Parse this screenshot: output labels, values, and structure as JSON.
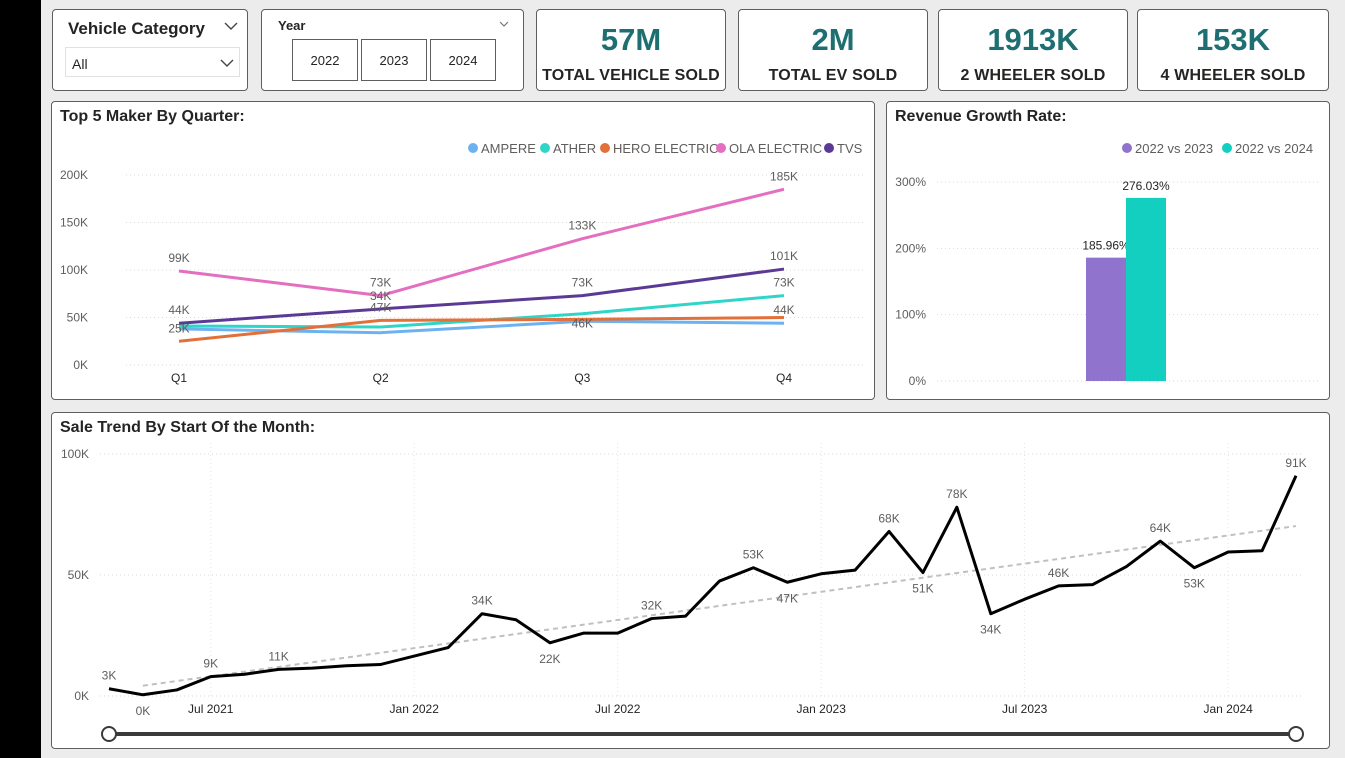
{
  "slicers": {
    "vehicle_category": {
      "title": "Vehicle Category",
      "selected": "All"
    },
    "year": {
      "title": "Year",
      "options": [
        "2022",
        "2023",
        "2024"
      ]
    }
  },
  "kpis": [
    {
      "value": "57M",
      "label": "TOTAL VEHICLE SOLD"
    },
    {
      "value": "2M",
      "label": "TOTAL EV SOLD"
    },
    {
      "value": "1913K",
      "label": "2 WHEELER SOLD"
    },
    {
      "value": "153K",
      "label": "4 WHEELER SOLD"
    }
  ],
  "colors": {
    "kpi_value": "#1e6f72",
    "ampere": "#6cb2f0",
    "ather": "#2fd5c8",
    "hero_electric": "#e2703a",
    "ola_electric": "#e46ec0",
    "tvs": "#5b3a96",
    "growth_2023": "#8f73cc",
    "growth_2024": "#12cfc0",
    "trend_line": "#000000",
    "trend_dashed": "#c0c0c0"
  },
  "chart_data": [
    {
      "type": "line",
      "title": "Top 5 Maker By Quarter:",
      "categories": [
        "Q1",
        "Q2",
        "Q3",
        "Q4"
      ],
      "yticks": [
        "0K",
        "50K",
        "100K",
        "150K",
        "200K"
      ],
      "ylim": [
        0,
        200000
      ],
      "legend": "top-right",
      "grid": true,
      "series": [
        {
          "name": "AMPERE",
          "color_key": "ampere",
          "values": [
            38000,
            34000,
            46000,
            44000
          ],
          "labels": [
            "",
            "",
            "",
            "44K"
          ]
        },
        {
          "name": "ATHER",
          "color_key": "ather",
          "values": [
            41000,
            40000,
            54000,
            73000
          ],
          "labels": [
            "",
            "",
            "",
            "73K"
          ]
        },
        {
          "name": "HERO ELECTRIC",
          "color_key": "hero_electric",
          "values": [
            25000,
            47000,
            48000,
            50000
          ],
          "labels": [
            "25K",
            "47K",
            "",
            ""
          ]
        },
        {
          "name": "OLA ELECTRIC",
          "color_key": "ola_electric",
          "values": [
            99000,
            73000,
            133000,
            185000
          ],
          "labels": [
            "99K",
            "73K",
            "133K",
            "185K"
          ]
        },
        {
          "name": "TVS",
          "color_key": "tvs",
          "values": [
            44000,
            59000,
            73000,
            101000
          ],
          "labels": [
            "44K",
            "34K",
            "73K",
            "101K"
          ]
        }
      ],
      "extra_labels": [
        "46K"
      ]
    },
    {
      "type": "bar",
      "title": "Revenue Growth Rate:",
      "yticks": [
        "0%",
        "100%",
        "200%",
        "300%"
      ],
      "ylim": [
        0,
        300
      ],
      "legend": "top-right",
      "grid": true,
      "series": [
        {
          "name": "2022 vs 2023",
          "color_key": "growth_2023",
          "value": 185.96,
          "label": "185.96%"
        },
        {
          "name": "2022 vs 2024",
          "color_key": "growth_2024",
          "value": 276.03,
          "label": "276.03%"
        }
      ]
    },
    {
      "type": "line",
      "title": "Sale Trend By Start Of the Month:",
      "xticks": [
        "Jul 2021",
        "Jan 2022",
        "Jul 2022",
        "Jan 2023",
        "Jul 2023",
        "Jan 2024"
      ],
      "yticks": [
        "0K",
        "50K",
        "100K"
      ],
      "ylim": [
        0,
        100000
      ],
      "trendline": true,
      "x_months": [
        "2021-04",
        "2021-05",
        "2021-06",
        "2021-07",
        "2021-08",
        "2021-09",
        "2021-10",
        "2021-11",
        "2021-12",
        "2022-01",
        "2022-02",
        "2022-03",
        "2022-04",
        "2022-05",
        "2022-06",
        "2022-07",
        "2022-08",
        "2022-09",
        "2022-10",
        "2022-11",
        "2022-12",
        "2023-01",
        "2023-02",
        "2023-03",
        "2023-04",
        "2023-05",
        "2023-06",
        "2023-07",
        "2023-08",
        "2023-09",
        "2023-10",
        "2023-11",
        "2023-12",
        "2024-01",
        "2024-02",
        "2024-03"
      ],
      "values": [
        3000,
        500,
        2500,
        8000,
        9000,
        11000,
        11500,
        12500,
        13000,
        16500,
        20000,
        34000,
        31500,
        22000,
        26000,
        26000,
        32000,
        33000,
        47500,
        53000,
        47000,
        50500,
        52000,
        68000,
        51000,
        78000,
        34000,
        40000,
        45500,
        46000,
        53500,
        64000,
        53000,
        59500,
        60000,
        91000
      ],
      "point_labels": [
        "3K",
        "0K",
        "",
        "9K",
        "",
        "11K",
        "",
        "",
        "",
        "",
        "",
        "34K",
        "",
        "22K",
        "",
        "",
        "32K",
        "",
        "",
        "53K",
        "47K",
        "",
        "",
        "68K",
        "51K",
        "78K",
        "34K",
        "",
        "46K",
        "",
        "",
        "64K",
        "53K",
        "",
        "",
        "91K"
      ]
    }
  ]
}
